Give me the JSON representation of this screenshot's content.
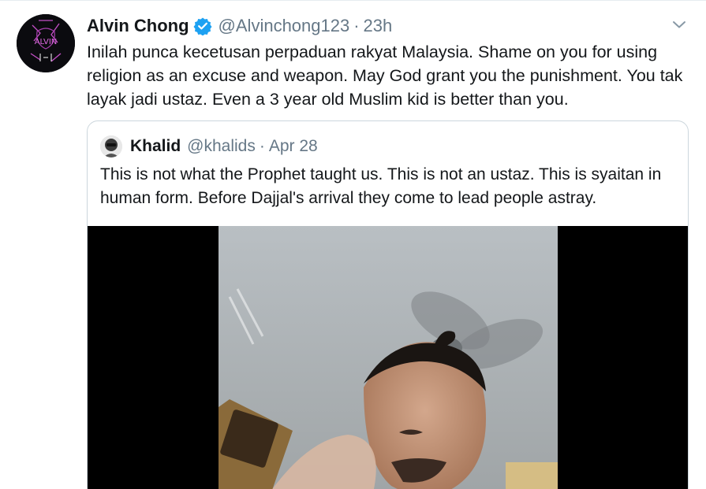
{
  "tweet": {
    "display_name": "Alvin Chong",
    "handle": "@Alvinchong123",
    "separator": "·",
    "time": "23h",
    "text": "Inilah punca kecetusan perpaduan rakyat Malaysia. Shame on you for using religion as an excuse and weapon. May God grant you the punishment. You tak layak jadi ustaz. Even a 3 year old Muslim kid is better than you.",
    "avatar_text": "ALVIN",
    "verified_icon": "verified-badge-icon",
    "menu_icon": "chevron-down-icon"
  },
  "quote": {
    "display_name": "Khalid",
    "handle": "@khalids",
    "separator": "·",
    "time": "Apr 28",
    "text": "This is not what the Prophet taught us. This is not an ustaz. This is syaitan in human form. Before Dajjal's arrival they come to lead people astray."
  },
  "colors": {
    "accent": "#1da1f2",
    "secondary_text": "#657786",
    "border": "#ccd6dd",
    "avatar_neon": "#d65bd9"
  }
}
